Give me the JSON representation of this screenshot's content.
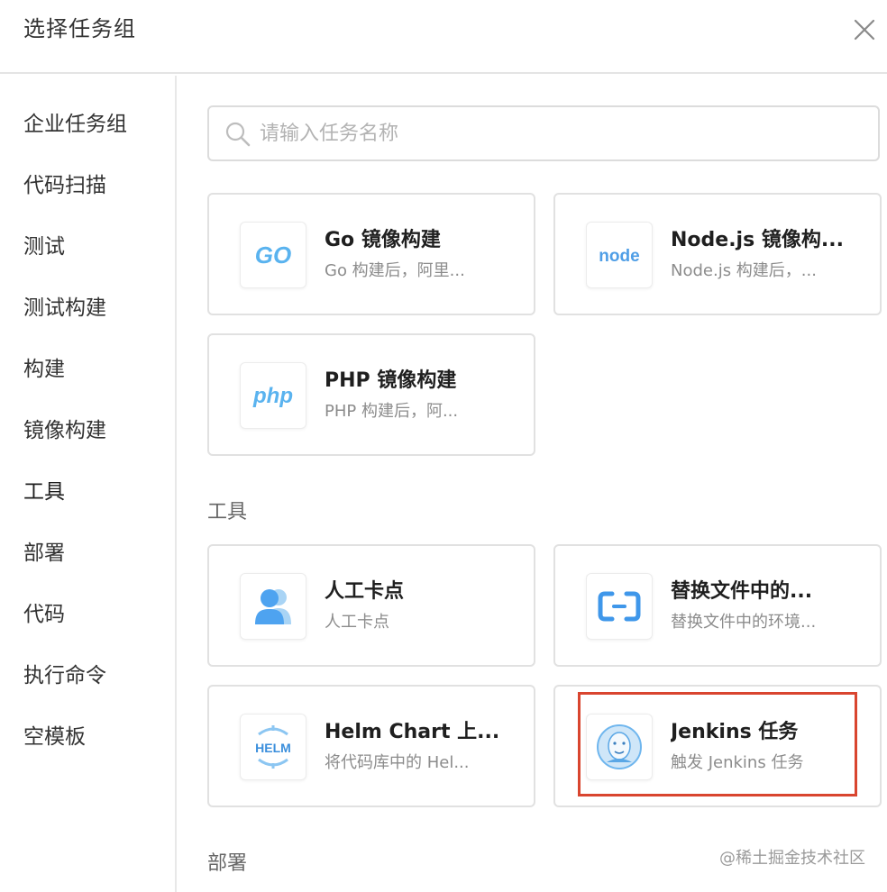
{
  "dialog": {
    "title": "选择任务组",
    "close_icon": "close-icon"
  },
  "sidebar": {
    "items": [
      {
        "label": "企业任务组"
      },
      {
        "label": "代码扫描"
      },
      {
        "label": "测试"
      },
      {
        "label": "测试构建"
      },
      {
        "label": "构建"
      },
      {
        "label": "镜像构建"
      },
      {
        "label": "工具",
        "active": true
      },
      {
        "label": "部署"
      },
      {
        "label": "代码"
      },
      {
        "label": "执行命令"
      },
      {
        "label": "空模板"
      }
    ]
  },
  "search": {
    "placeholder": "请输入任务名称",
    "value": "",
    "icon": "search-icon"
  },
  "sections": {
    "image_build": {
      "cards": [
        {
          "title": "Go 镜像构建",
          "desc": "Go 构建后，阿里...",
          "icon": "go-icon",
          "icon_text": "GO"
        },
        {
          "title": "Node.js 镜像构...",
          "desc": "Node.js 构建后，...",
          "icon": "nodejs-icon",
          "icon_text": "node"
        },
        {
          "title": "PHP 镜像构建",
          "desc": "PHP 构建后，阿...",
          "icon": "php-icon",
          "icon_text": "php"
        }
      ]
    },
    "tools": {
      "label": "工具",
      "cards": [
        {
          "title": "人工卡点",
          "desc": "人工卡点",
          "icon": "manual-gate-user-icon"
        },
        {
          "title": "替换文件中的...",
          "desc": "替换文件中的环境...",
          "icon": "replace-file-icon"
        },
        {
          "title": "Helm Chart 上...",
          "desc": "将代码库中的 Hel...",
          "icon": "helm-icon",
          "icon_text": "HELM"
        },
        {
          "title": "Jenkins 任务",
          "desc": "触发 Jenkins 任务",
          "icon": "jenkins-icon"
        }
      ]
    },
    "deploy": {
      "label": "部署"
    }
  },
  "watermark": "@稀土掘金技术社区",
  "colors": {
    "accent_blue": "#4ea3f0",
    "highlight_red": "#d9452f",
    "border": "#e1e1e1"
  }
}
